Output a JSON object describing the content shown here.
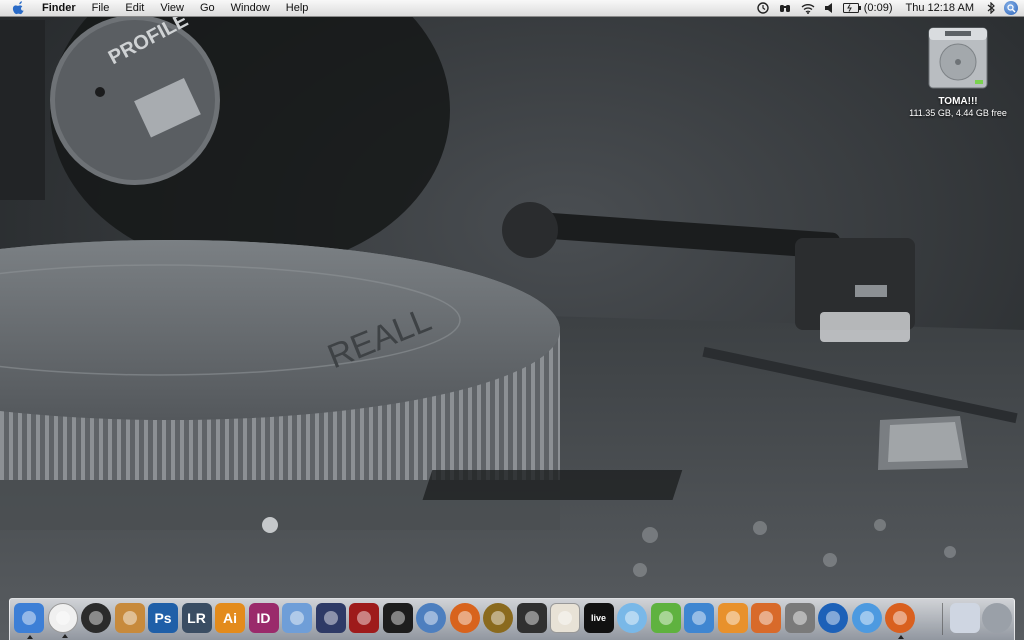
{
  "menubar": {
    "app_name": "Finder",
    "menus": [
      "File",
      "Edit",
      "View",
      "Go",
      "Window",
      "Help"
    ],
    "battery": "(0:09)",
    "clock": "Thu 12:18 AM"
  },
  "desktop": {
    "drive": {
      "name": "TOMA!!!",
      "info": "111.35 GB, 4.44 GB free"
    }
  },
  "wallpaper": {
    "record_label": "PROFILE",
    "platter_text": "REALL"
  },
  "dock": {
    "icons": [
      {
        "name": "finder-icon",
        "text": "",
        "bg": "#3d7fd6",
        "running": true
      },
      {
        "name": "adium-icon",
        "text": "",
        "bg": "#f0f0f0",
        "running": true
      },
      {
        "name": "aperture-icon",
        "text": "",
        "bg": "#2b2b2b",
        "running": false
      },
      {
        "name": "iphoto-icon",
        "text": "",
        "bg": "#c78a3c",
        "running": false
      },
      {
        "name": "photoshop-icon",
        "text": "Ps",
        "bg": "#1f5fa8",
        "running": false
      },
      {
        "name": "lightroom-icon",
        "text": "LR",
        "bg": "#3a4d63",
        "running": false
      },
      {
        "name": "illustrator-icon",
        "text": "Ai",
        "bg": "#e38b1c",
        "running": false
      },
      {
        "name": "indesign-icon",
        "text": "ID",
        "bg": "#9a2a6b",
        "running": false
      },
      {
        "name": "numbers-icon",
        "text": "",
        "bg": "#6f9ed8",
        "running": false
      },
      {
        "name": "pen-tool-icon",
        "text": "",
        "bg": "#2e3a66",
        "running": false
      },
      {
        "name": "film-icon",
        "text": "",
        "bg": "#9e1b1b",
        "running": false
      },
      {
        "name": "clapperboard-icon",
        "text": "",
        "bg": "#1d1d1d",
        "running": false
      },
      {
        "name": "recycle-icon",
        "text": "",
        "bg": "#4d7fbf",
        "running": false
      },
      {
        "name": "reason-icon",
        "text": "",
        "bg": "#d8631d",
        "running": false
      },
      {
        "name": "logic-icon",
        "text": "",
        "bg": "#8a6a1e",
        "running": false
      },
      {
        "name": "dvd-player-icon",
        "text": "",
        "bg": "#303030",
        "running": false
      },
      {
        "name": "megaphone-icon",
        "text": "",
        "bg": "#e8e2d6",
        "running": false
      },
      {
        "name": "ableton-live-icon",
        "text": "live",
        "bg": "#111111",
        "running": false
      },
      {
        "name": "itunes-icon",
        "text": "",
        "bg": "#79b8e8",
        "running": false
      },
      {
        "name": "dashcode-icon",
        "text": "",
        "bg": "#5fb23f",
        "running": false
      },
      {
        "name": "wiimote-icon",
        "text": "",
        "bg": "#3f86d1",
        "running": false
      },
      {
        "name": "pages-icon",
        "text": "",
        "bg": "#e8912c",
        "running": false
      },
      {
        "name": "keynote-icon",
        "text": "",
        "bg": "#d86a2a",
        "running": false
      },
      {
        "name": "imovie-icon",
        "text": "",
        "bg": "#7a7a7a",
        "running": false
      },
      {
        "name": "dvd-studio-icon",
        "text": "",
        "bg": "#1d61b8",
        "running": false
      },
      {
        "name": "safari-icon",
        "text": "",
        "bg": "#4d9ae0",
        "running": false
      },
      {
        "name": "firefox-icon",
        "text": "",
        "bg": "#d9601f",
        "running": true
      }
    ],
    "right_icons": [
      {
        "name": "downloads-stack-icon",
        "bg": "#cfd6e2"
      },
      {
        "name": "trash-icon",
        "bg": "#9aa0a8"
      }
    ]
  }
}
